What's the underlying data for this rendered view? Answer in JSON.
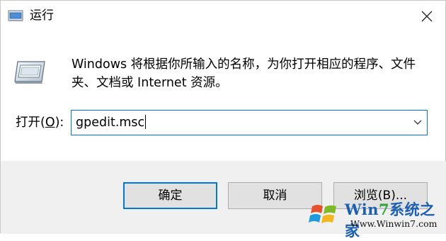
{
  "window": {
    "title": "运行",
    "close_icon": "close-icon"
  },
  "description": "Windows 将根据你所输入的名称，为你打开相应的程序、文件夹、文档或 Internet 资源。",
  "open_field": {
    "label_prefix": "打开(",
    "label_key": "O",
    "label_suffix": "):",
    "value": "gpedit.msc"
  },
  "buttons": {
    "ok": "确定",
    "cancel": "取消",
    "browse": "浏览(B)..."
  },
  "watermark": {
    "brand_prefix": "Win",
    "brand_digit": "7",
    "brand_suffix": "系统之家",
    "url": "Www.Winwin7.com"
  },
  "colors": {
    "focus_blue": "#0078d7",
    "footer_bg": "#f0f0f0",
    "button_bg": "#e1e1e1"
  }
}
